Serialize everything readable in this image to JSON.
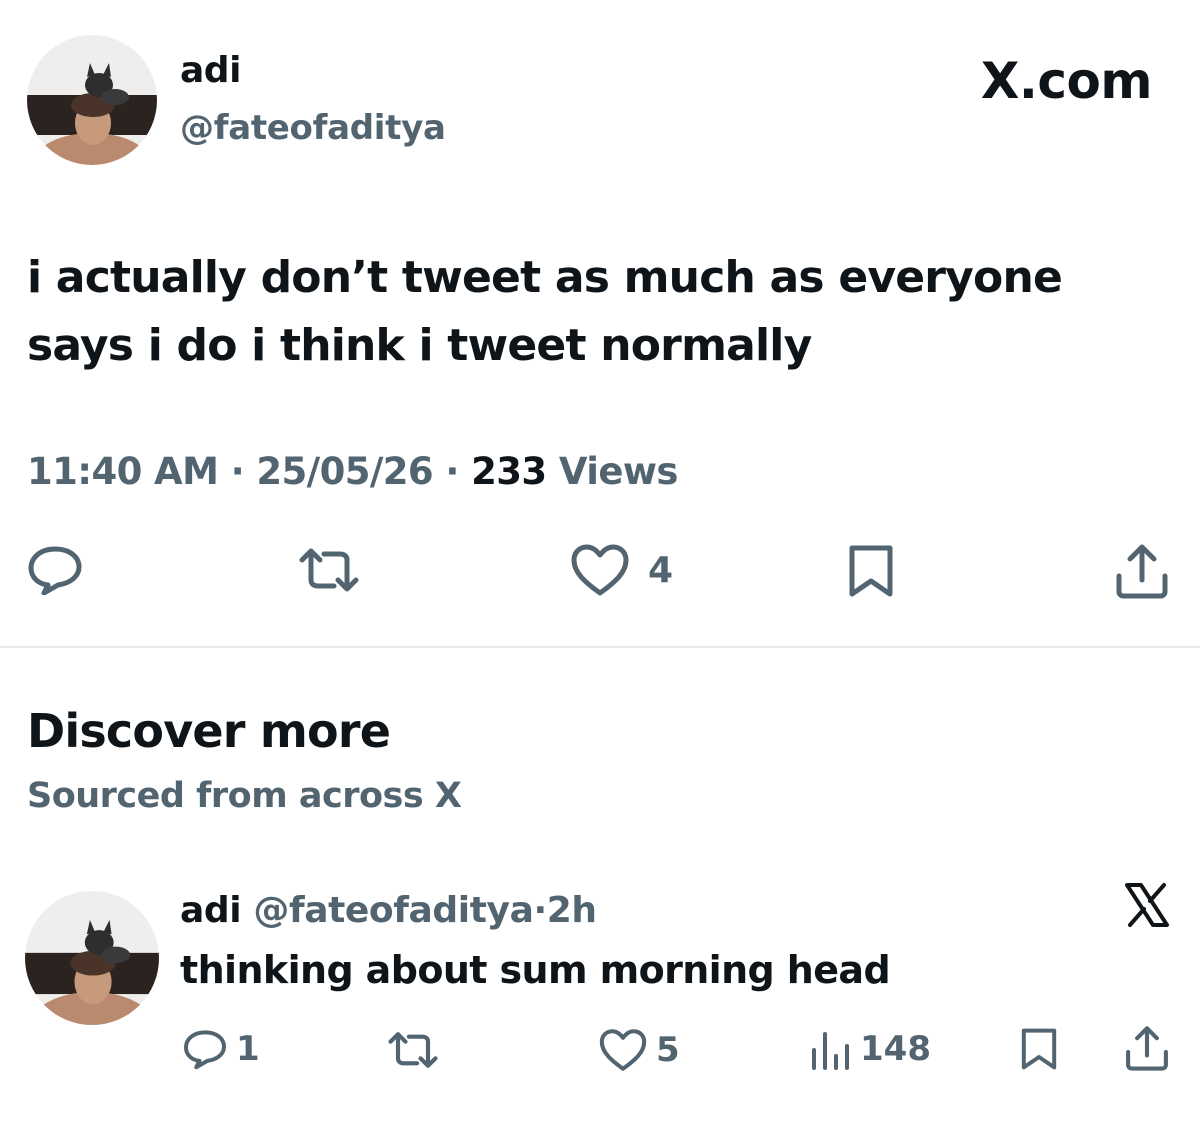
{
  "main_tweet": {
    "author_name": "adi",
    "author_handle": "@fateofaditya",
    "brand": "X.com",
    "text": "i actually don’t tweet as much as everyone says i do i think i tweet normally",
    "time": "11:40 AM",
    "date": "25/05/26",
    "views_count": "233",
    "views_label": "Views",
    "separator": "·",
    "actions": {
      "reply_icon": "reply-icon",
      "retweet_icon": "retweet-icon",
      "like_icon": "heart-icon",
      "like_count": "4",
      "bookmark_icon": "bookmark-icon",
      "share_icon": "share-icon"
    }
  },
  "discover": {
    "title": "Discover more",
    "subtitle": "Sourced from across X"
  },
  "suggested_tweet": {
    "author_name": "adi",
    "author_handle": "@fateofaditya",
    "separator": "·",
    "time_ago": "2h",
    "text": "thinking about sum morning head",
    "close_icon": "x-logo-icon",
    "actions": {
      "reply_count": "1",
      "like_count": "5",
      "views_count": "148"
    }
  },
  "colors": {
    "text_primary": "#0f1419",
    "text_secondary": "#536471",
    "divider": "#e6e9eb"
  }
}
